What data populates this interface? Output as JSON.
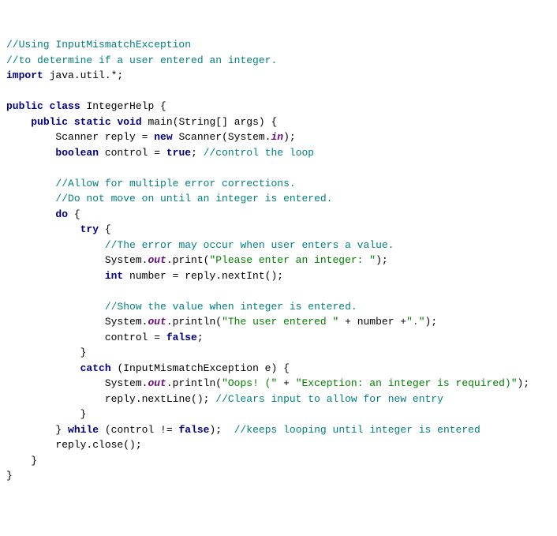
{
  "lines": {
    "c1": "//Using InputMismatchException",
    "c2": "//to determine if a user entered an integer.",
    "kw_import": "import",
    "import_pkg": " java.util.*;",
    "kw_public": "public",
    "kw_class": "class",
    "cls_name": " IntegerHelp {",
    "kw_static": "static",
    "kw_void": "void",
    "main_sig": " main(String[] args) {",
    "scanner_decl1": "Scanner reply = ",
    "kw_new": "new",
    "scanner_decl2": " Scanner(System.",
    "in_field": "in",
    "scanner_decl3": ");",
    "kw_boolean": "boolean",
    "control_decl1": " control = ",
    "kw_true": "true",
    "control_decl2": "; ",
    "c_control": "//control the loop",
    "c_allow": "//Allow for multiple error corrections.",
    "c_donot": "//Do not move on until an integer is entered.",
    "kw_do": "do",
    "do_open": " {",
    "kw_try": "try",
    "try_open": " {",
    "c_error": "//The error may occur when user enters a value.",
    "sys1": "System.",
    "out_field": "out",
    "print1": ".print(",
    "str_prompt": "\"Please enter an integer: \"",
    "print1_end": ");",
    "kw_int": "int",
    "number_decl": " number = reply.nextInt();",
    "c_show": "//Show the value when integer is entered.",
    "println1": ".println(",
    "str_entered": "\"The user entered \"",
    "plus_number": " + number +",
    "str_period": "\".\"",
    "println1_end": ");",
    "control_false1": "control = ",
    "kw_false": "false",
    "control_false2": ";",
    "try_close": "}",
    "kw_catch": "catch",
    "catch_sig": " (InputMismatchException e) {",
    "println2": ".println(",
    "str_oops": "\"Oops! (\"",
    "plus": " + ",
    "str_exception": "\"Exception: an integer is required)\"",
    "println2_end": ");",
    "nextline": "reply.nextLine(); ",
    "c_clears": "//Clears input to allow for new entry",
    "catch_close": "}",
    "while_open": "} ",
    "kw_while": "while",
    "while_cond1": " (control != ",
    "while_cond2": ");  ",
    "c_keeps": "//keeps looping until integer is entered",
    "reply_close": "reply.close();",
    "main_close": "}",
    "class_close": "}"
  }
}
